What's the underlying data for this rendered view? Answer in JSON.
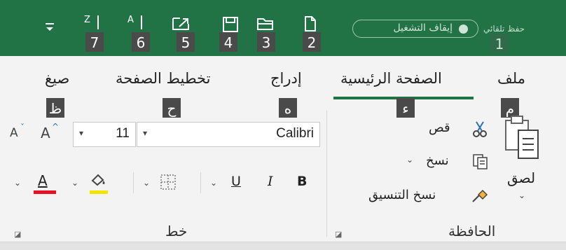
{
  "title_bar": {
    "autosave_label": "حفظ تلقائي",
    "autosave_toggle_label": "إيقاف التشغيل",
    "qat_keytips": [
      "1",
      "2",
      "3",
      "4",
      "5",
      "6",
      "7"
    ]
  },
  "tabs": [
    {
      "label": "ملف",
      "keytip": "م"
    },
    {
      "label": "الصفحة الرئيسية",
      "keytip": "ء"
    },
    {
      "label": "إدراج",
      "keytip": "ه"
    },
    {
      "label": "تخطيط الصفحة",
      "keytip": "ح"
    },
    {
      "label": "صيغ",
      "keytip": "ظ"
    }
  ],
  "clipboard": {
    "group_label": "الحافظة",
    "paste_label": "لصق",
    "cut_label": "قص",
    "copy_label": "نسخ",
    "format_painter_label": "نسخ التنسيق"
  },
  "font": {
    "group_label": "خط",
    "font_name": "Calibri",
    "font_size": "11",
    "bold_label": "B",
    "italic_label": "I",
    "underline_label": "U",
    "font_color_letter": "A",
    "grow_font_label": "A",
    "shrink_font_label": "A"
  },
  "colors": {
    "title_bar_bg": "#217346",
    "active_tab_underline": "#217346",
    "font_color_bar": "#e81123",
    "highlight_bar": "#f2e600",
    "keytip_bg": "#4a4a4a"
  }
}
